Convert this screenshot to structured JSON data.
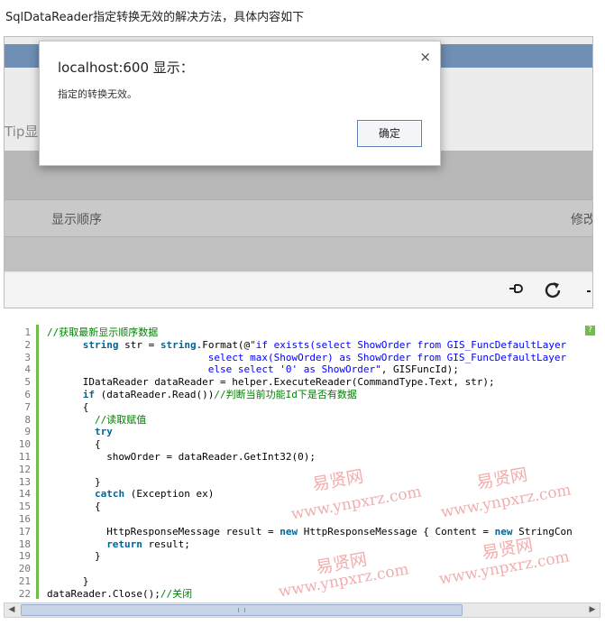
{
  "heading": "SqlDataReader指定转换无效的解决方法，具体内容如下",
  "screenshot": {
    "tip_label": "Tip显示",
    "columns": [
      "显示顺序",
      "修改"
    ]
  },
  "dialog": {
    "title": "localhost:600 显示：",
    "message": "指定的转换无效。",
    "ok_label": "确定",
    "close_glyph": "×"
  },
  "code": {
    "help_glyph": "?",
    "lines": [
      {
        "n": "1",
        "indent": 0,
        "parts": [
          {
            "t": "//获取最新显示顺序数据",
            "c": "cm"
          }
        ]
      },
      {
        "n": "2",
        "indent": 6,
        "parts": [
          {
            "t": "string",
            "c": "kw"
          },
          {
            "t": " str = "
          },
          {
            "t": "string",
            "c": "kw"
          },
          {
            "t": ".Format(@"
          },
          {
            "t": "\"if exists(select ShowOrder from GIS_FuncDefaultLayer",
            "c": "str"
          }
        ]
      },
      {
        "n": "3",
        "indent": 27,
        "parts": [
          {
            "t": "select max(ShowOrder) as ShowOrder from GIS_FuncDefaultLayer",
            "c": "str"
          }
        ]
      },
      {
        "n": "4",
        "indent": 27,
        "parts": [
          {
            "t": "else select '0' as ShowOrder\"",
            "c": "str"
          },
          {
            "t": ", GISFuncId);"
          }
        ]
      },
      {
        "n": "5",
        "indent": 6,
        "parts": [
          {
            "t": "IDataReader dataReader = helper.ExecuteReader(CommandType.Text, str);"
          }
        ]
      },
      {
        "n": "6",
        "indent": 6,
        "parts": [
          {
            "t": "if",
            "c": "kw"
          },
          {
            "t": " (dataReader.Read())"
          },
          {
            "t": "//判断当前功能Id下是否有数据",
            "c": "cm"
          }
        ]
      },
      {
        "n": "7",
        "indent": 6,
        "parts": [
          {
            "t": "{"
          }
        ]
      },
      {
        "n": "8",
        "indent": 8,
        "parts": [
          {
            "t": "//读取赋值",
            "c": "cm"
          }
        ]
      },
      {
        "n": "9",
        "indent": 8,
        "parts": [
          {
            "t": "try",
            "c": "kw"
          }
        ]
      },
      {
        "n": "10",
        "indent": 8,
        "parts": [
          {
            "t": "{"
          }
        ]
      },
      {
        "n": "11",
        "indent": 10,
        "parts": [
          {
            "t": "showOrder = dataReader.GetInt32(0);"
          }
        ]
      },
      {
        "n": "12",
        "indent": 0,
        "parts": [
          {
            "t": ""
          }
        ]
      },
      {
        "n": "13",
        "indent": 8,
        "parts": [
          {
            "t": "}"
          }
        ]
      },
      {
        "n": "14",
        "indent": 8,
        "parts": [
          {
            "t": "catch",
            "c": "kw"
          },
          {
            "t": " (Exception ex)"
          }
        ]
      },
      {
        "n": "15",
        "indent": 8,
        "parts": [
          {
            "t": "{"
          }
        ]
      },
      {
        "n": "16",
        "indent": 0,
        "parts": [
          {
            "t": ""
          }
        ]
      },
      {
        "n": "17",
        "indent": 10,
        "parts": [
          {
            "t": "HttpResponseMessage result = "
          },
          {
            "t": "new",
            "c": "kw"
          },
          {
            "t": " HttpResponseMessage { Content = "
          },
          {
            "t": "new",
            "c": "kw"
          },
          {
            "t": " StringCon"
          }
        ]
      },
      {
        "n": "18",
        "indent": 10,
        "parts": [
          {
            "t": "return",
            "c": "kw"
          },
          {
            "t": " result;"
          }
        ]
      },
      {
        "n": "19",
        "indent": 8,
        "parts": [
          {
            "t": "}"
          }
        ]
      },
      {
        "n": "20",
        "indent": 0,
        "parts": [
          {
            "t": ""
          }
        ]
      },
      {
        "n": "21",
        "indent": 6,
        "parts": [
          {
            "t": "}"
          }
        ]
      },
      {
        "n": "22",
        "indent": 0,
        "parts": [
          {
            "t": "dataReader.Close();"
          },
          {
            "t": "//关闭",
            "c": "cm"
          }
        ]
      }
    ]
  },
  "watermark": {
    "cn": "易贤网",
    "url": "www.ynpxrz.com"
  },
  "colors": {
    "accent_green": "#6fbe4a",
    "watermark_red": "#e86c6c",
    "header_blue": "#6f8fb5"
  }
}
